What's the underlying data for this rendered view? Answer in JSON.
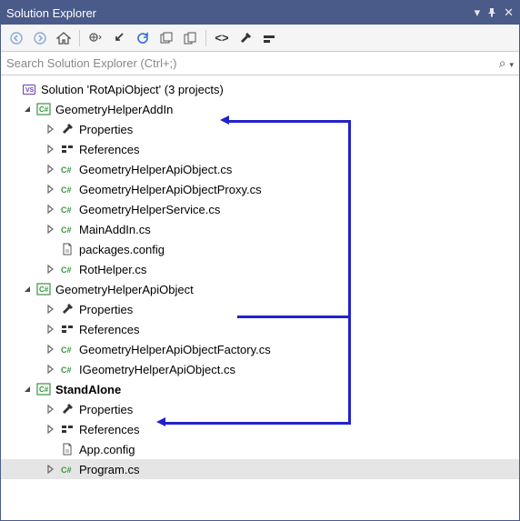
{
  "titlebar": {
    "caption": "Solution Explorer"
  },
  "search": {
    "placeholder": "Search Solution Explorer (Ctrl+;)"
  },
  "solution": {
    "label": "Solution 'RotApiObject' (3 projects)"
  },
  "projects": [
    {
      "name": "GeometryHelperAddIn",
      "bold": false,
      "items": [
        {
          "kind": "folder-prop",
          "label": "Properties",
          "expandable": true
        },
        {
          "kind": "refs",
          "label": "References",
          "expandable": true
        },
        {
          "kind": "cs",
          "label": "GeometryHelperApiObject.cs",
          "expandable": true
        },
        {
          "kind": "cs",
          "label": "GeometryHelperApiObjectProxy.cs",
          "expandable": true
        },
        {
          "kind": "cs",
          "label": "GeometryHelperService.cs",
          "expandable": true
        },
        {
          "kind": "cs",
          "label": "MainAddIn.cs",
          "expandable": true
        },
        {
          "kind": "config",
          "label": "packages.config",
          "expandable": false
        },
        {
          "kind": "cs",
          "label": "RotHelper.cs",
          "expandable": true
        }
      ]
    },
    {
      "name": "GeometryHelperApiObject",
      "bold": false,
      "items": [
        {
          "kind": "folder-prop",
          "label": "Properties",
          "expandable": true
        },
        {
          "kind": "refs",
          "label": "References",
          "expandable": true
        },
        {
          "kind": "cs",
          "label": "GeometryHelperApiObjectFactory.cs",
          "expandable": true
        },
        {
          "kind": "cs",
          "label": "IGeometryHelperApiObject.cs",
          "expandable": true
        }
      ]
    },
    {
      "name": "StandAlone",
      "bold": true,
      "items": [
        {
          "kind": "folder-prop",
          "label": "Properties",
          "expandable": true
        },
        {
          "kind": "refs",
          "label": "References",
          "expandable": true
        },
        {
          "kind": "config",
          "label": "App.config",
          "expandable": false
        },
        {
          "kind": "cs",
          "label": "Program.cs",
          "expandable": true,
          "selected": true
        }
      ]
    }
  ]
}
